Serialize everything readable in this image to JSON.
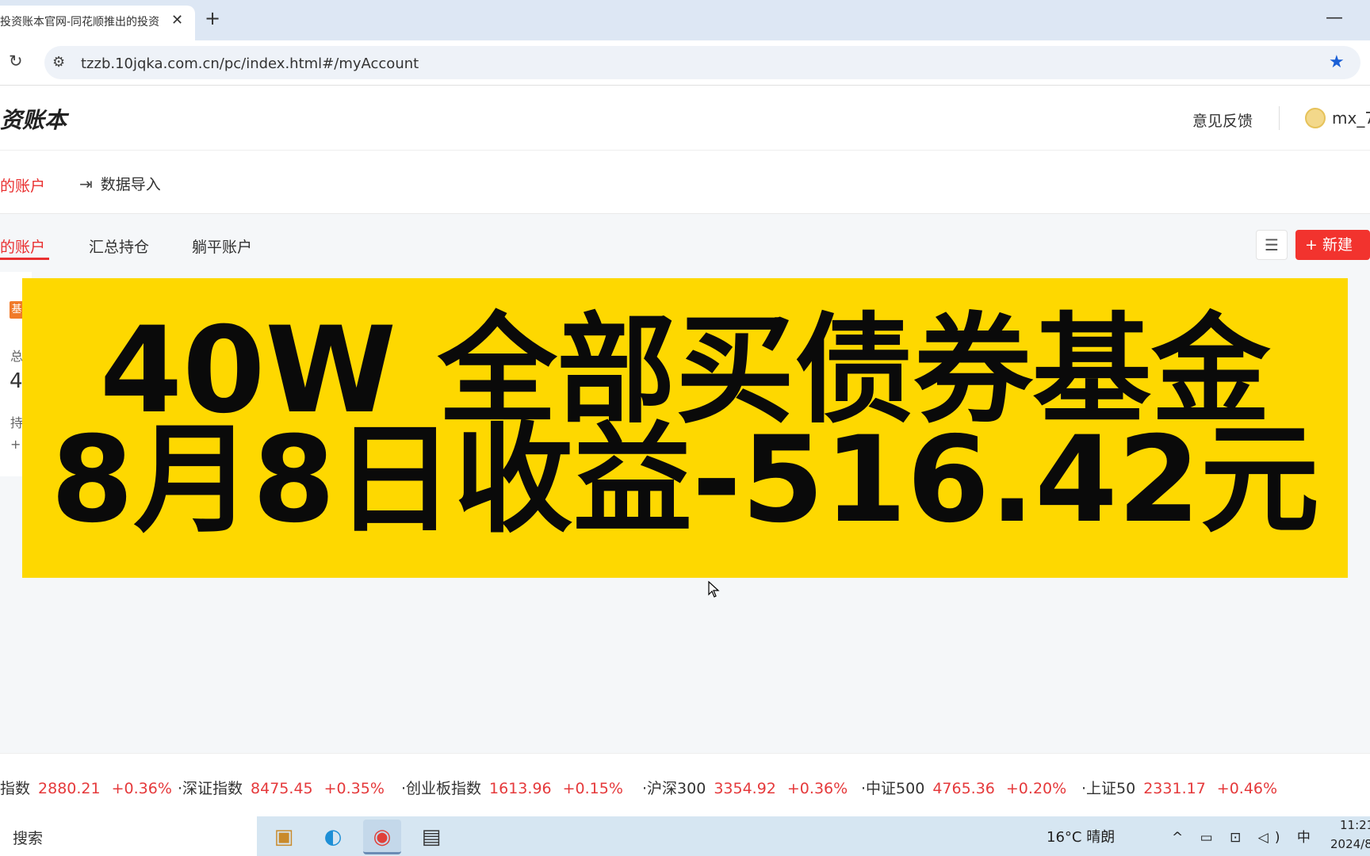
{
  "browser": {
    "tab_title": "投资账本官网-同花顺推出的投资",
    "tab_close": "✕",
    "new_tab": "+",
    "minimize": "—",
    "reload_icon": "reload-icon",
    "url": "tzzb.10jqka.com.cn/pc/index.html#/myAccount"
  },
  "header": {
    "logo": "资账本",
    "feedback": "意见反馈",
    "username": "mx_7"
  },
  "nav": {
    "my_account": "的账户",
    "data_import": "数据导入"
  },
  "subtabs": [
    {
      "label": "的账户",
      "active": true
    },
    {
      "label": "汇总持仓",
      "active": false
    },
    {
      "label": "躺平账户",
      "active": false
    }
  ],
  "actions": {
    "new_label": "+ 新建"
  },
  "card": {
    "badge": "基",
    "t1": "总",
    "t2": "4",
    "t3": "持",
    "t4": "+"
  },
  "banner": {
    "line1": "40W  全部买债券基金",
    "line2": "8月8日收益-516.42元",
    "color": "#fed800"
  },
  "ticker": [
    {
      "name": "指数",
      "value": "2880.21",
      "change": "+0.36%"
    },
    {
      "name": "·深证指数",
      "value": "8475.45",
      "change": "+0.35%"
    },
    {
      "name": "·创业板指数",
      "value": "1613.96",
      "change": "+0.15%"
    },
    {
      "name": "·沪深300",
      "value": "3354.92",
      "change": "+0.36%"
    },
    {
      "name": "·中证500",
      "value": "4765.36",
      "change": "+0.20%"
    },
    {
      "name": "·上证50",
      "value": "2331.17",
      "change": "+0.46%"
    }
  ],
  "taskbar": {
    "search": "搜索",
    "weather": "16°C  晴朗",
    "tray": "^ ▭ ⊡ ◁) 中",
    "time": "11:21",
    "date": "2024/8"
  },
  "colors": {
    "accent_red": "#e93030",
    "rise_red": "#e5393b",
    "star_blue": "#1a5fd6"
  }
}
